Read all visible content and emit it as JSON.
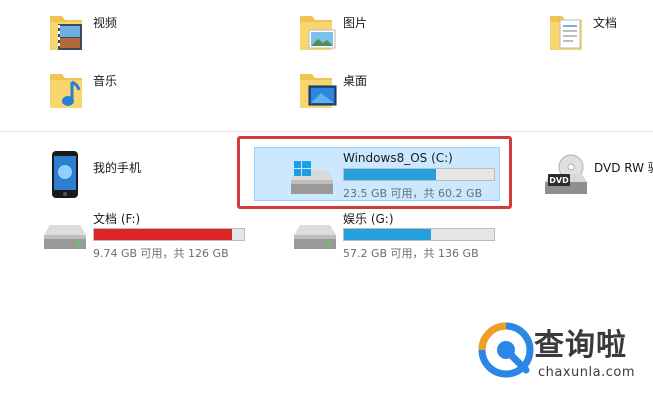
{
  "folders": [
    {
      "label": "视频",
      "icon": "video-folder-icon"
    },
    {
      "label": "图片",
      "icon": "pictures-folder-icon"
    },
    {
      "label": "文档",
      "icon": "documents-folder-icon"
    },
    {
      "label": "音乐",
      "icon": "music-folder-icon"
    },
    {
      "label": "桌面",
      "icon": "desktop-folder-icon"
    }
  ],
  "devices": [
    {
      "label": "我的手机",
      "icon": "phone-icon"
    },
    {
      "label": "Windows8_OS (C:)",
      "free": "23.5 GB 可用，共 60.2 GB",
      "used_fraction": 0.61,
      "bar_color": "#26a0da",
      "icon": "windows-drive-icon"
    },
    {
      "label": "DVD RW 驱",
      "icon": "dvd-drive-icon"
    },
    {
      "label": "文档 (F:)",
      "free": "9.74 GB 可用，共 126 GB",
      "used_fraction": 0.92,
      "bar_color": "#da2626",
      "icon": "hard-drive-icon"
    },
    {
      "label": "娱乐 (G:)",
      "free": "57.2 GB 可用，共 136 GB",
      "used_fraction": 0.58,
      "bar_color": "#26a0da",
      "icon": "hard-drive-icon"
    }
  ],
  "watermark": {
    "name": "查询啦",
    "domain": "chaxunla.com",
    "accent": "#2b86e6"
  }
}
